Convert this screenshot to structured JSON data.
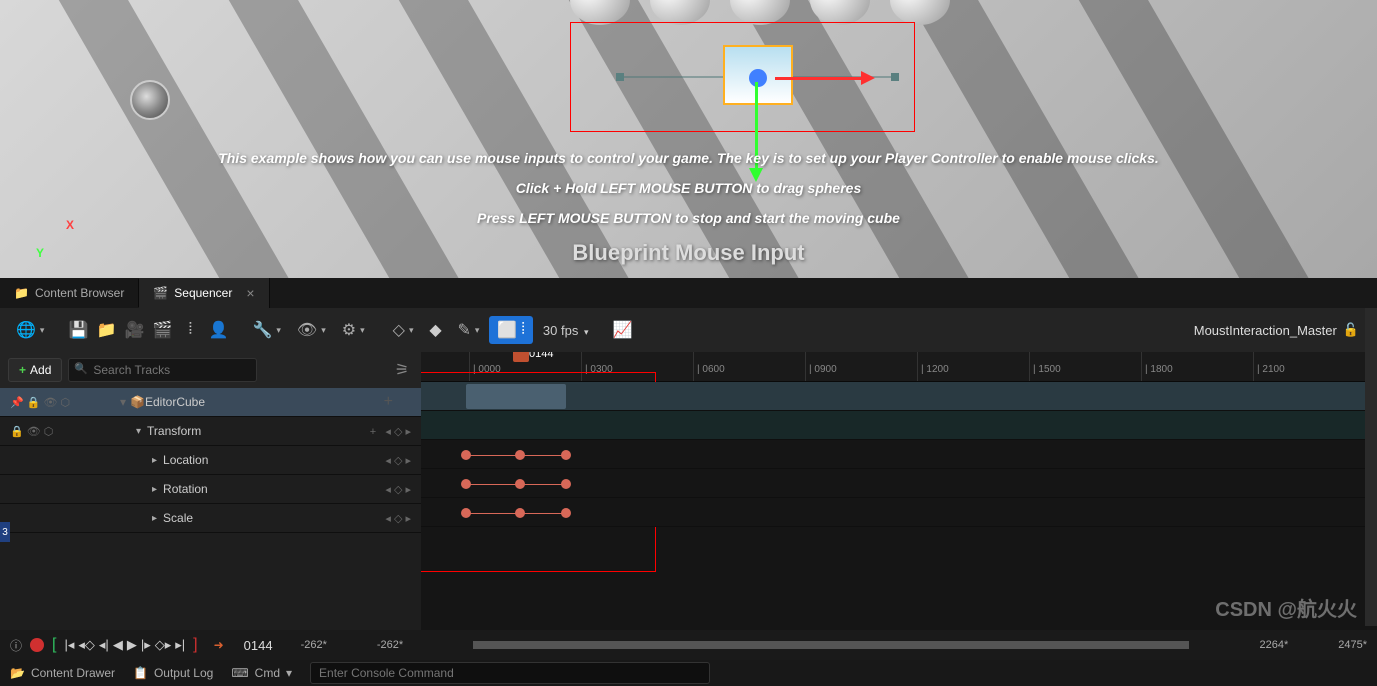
{
  "viewport": {
    "text1": "This example shows how you can use mouse inputs to control your game. The key is to set up your Player Controller to enable mouse clicks.",
    "text2": "Click + Hold LEFT MOUSE BUTTON to drag spheres",
    "text3": "Press LEFT MOUSE BUTTON to stop and start the moving cube",
    "text4": "Blueprint Mouse Input",
    "axis_x": "X",
    "axis_y": "Y",
    "axis_z": ""
  },
  "tabs": {
    "content_browser": "Content Browser",
    "sequencer": "Sequencer",
    "close": "×"
  },
  "toolbar": {
    "fps": "30 fps",
    "sequence_name": "MoustInteraction_Master"
  },
  "tracks": {
    "add_label": "Add",
    "search_placeholder": "Search Tracks",
    "editor_cube": "EditorCube",
    "transform": "Transform",
    "location": "Location",
    "rotation": "Rotation",
    "scale": "Scale"
  },
  "timeline": {
    "playhead_frame": "0144",
    "ticks": [
      "0000",
      "0300",
      "0600",
      "0900",
      "1200",
      "1500",
      "1800",
      "2100"
    ]
  },
  "transport": {
    "current_frame": "0144",
    "range_left_a": "-262*",
    "range_left_b": "-262*",
    "range_right_a": "2264*",
    "range_right_b": "2475*"
  },
  "status": {
    "content_drawer": "Content Drawer",
    "output_log": "Output Log",
    "cmd": "Cmd",
    "cmd_dropdown": "▾",
    "console_placeholder": "Enter Console Command",
    "watermark": "CSDN @航火火"
  },
  "side_tab": "3"
}
